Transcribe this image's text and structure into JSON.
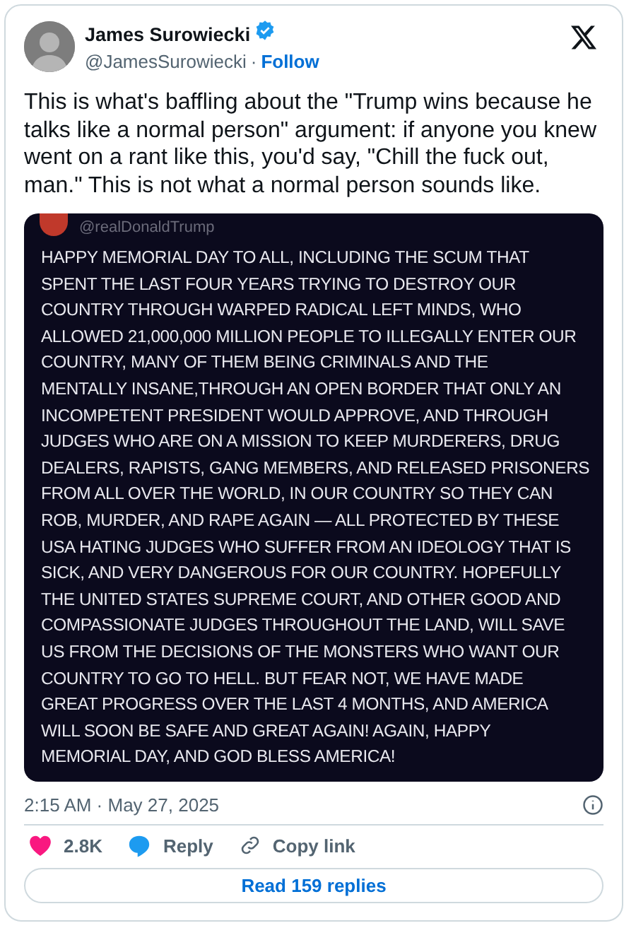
{
  "author": {
    "name": "James Surowiecki",
    "verified": true,
    "handle": "@JamesSurowiecki",
    "separator": "·",
    "follow": "Follow"
  },
  "text": "This is what's baffling about the \"Trump wins because he talks like a normal person\" argument: if anyone you knew went on a rant like this, you'd say, \"Chill the fuck out, man.\" This is not what a normal person sounds like.",
  "media": {
    "kind": "screenshot",
    "handle": "@realDonaldTrump",
    "lines": [
      "HAPPY MEMORIAL DAY TO ALL, INCLUDING THE SCUM THAT",
      "SPENT THE LAST FOUR YEARS TRYING TO DESTROY OUR",
      "COUNTRY THROUGH WARPED RADICAL LEFT MINDS, WHO",
      "ALLOWED 21,000,000 MILLION PEOPLE TO ILLEGALLY ENTER OUR",
      "COUNTRY, MANY OF THEM BEING CRIMINALS AND THE",
      "MENTALLY INSANE,THROUGH AN OPEN BORDER THAT ONLY AN",
      "INCOMPETENT PRESIDENT WOULD APPROVE, AND THROUGH",
      "JUDGES WHO ARE ON A MISSION TO KEEP MURDERERS, DRUG",
      "DEALERS, RAPISTS, GANG MEMBERS, AND RELEASED PRISONERS",
      "FROM ALL OVER THE WORLD, IN OUR COUNTRY SO THEY CAN",
      "ROB, MURDER, AND RAPE AGAIN — ALL PROTECTED BY THESE",
      "USA HATING JUDGES WHO SUFFER FROM AN IDEOLOGY THAT IS",
      "SICK, AND VERY DANGEROUS FOR OUR COUNTRY. HOPEFULLY",
      "THE UNITED STATES SUPREME COURT, AND OTHER GOOD AND",
      "COMPASSIONATE JUDGES THROUGHOUT THE LAND, WILL SAVE",
      "US FROM THE DECISIONS OF THE MONSTERS WHO WANT OUR",
      "COUNTRY TO GO TO HELL. BUT FEAR NOT, WE HAVE MADE",
      "GREAT PROGRESS OVER THE LAST 4 MONTHS, AND AMERICA",
      "WILL SOON BE SAFE AND GREAT AGAIN! AGAIN, HAPPY",
      "MEMORIAL DAY, AND GOD BLESS AMERICA!"
    ]
  },
  "timestamp": "2:15 AM · May 27, 2025",
  "actions": [
    {
      "kind": "like",
      "label": "2.8K"
    },
    {
      "kind": "reply",
      "label": "Reply"
    },
    {
      "kind": "copy",
      "label": "Copy link"
    }
  ],
  "read_replies": "Read 159 replies"
}
